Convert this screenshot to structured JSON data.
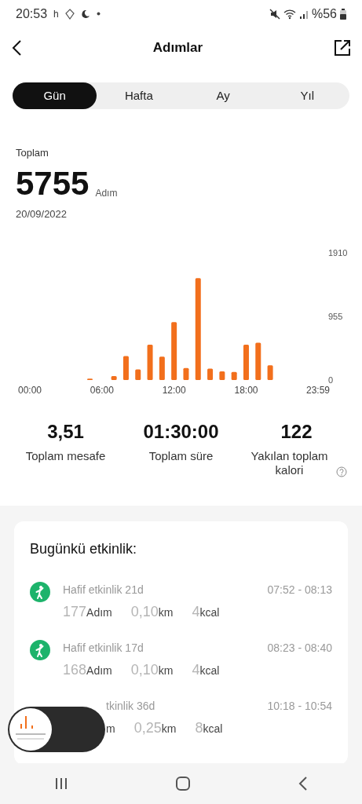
{
  "status_bar": {
    "time": "20:53",
    "left_glyph": "h",
    "battery": "%56"
  },
  "header": {
    "title": "Adımlar"
  },
  "tabs": [
    {
      "label": "Gün",
      "selected": true
    },
    {
      "label": "Hafta",
      "selected": false
    },
    {
      "label": "Ay",
      "selected": false
    },
    {
      "label": "Yıl",
      "selected": false
    }
  ],
  "summary": {
    "label": "Toplam",
    "value": "5755",
    "unit": "Adım",
    "date": "20/09/2022"
  },
  "chart": {
    "chart_data": {
      "type": "bar",
      "x": [
        0,
        1,
        2,
        3,
        4,
        5,
        6,
        7,
        8,
        9,
        10,
        11,
        12,
        13,
        14,
        15,
        16,
        17,
        18,
        19,
        20,
        21,
        22,
        23
      ],
      "xlim": [
        0,
        23.98
      ],
      "series": [
        {
          "color": "#f26f1c",
          "values": [
            0,
            0,
            0,
            0,
            0,
            20,
            0,
            60,
            360,
            160,
            530,
            350,
            870,
            180,
            1530,
            170,
            130,
            120,
            530,
            560,
            220,
            0,
            0,
            0
          ]
        }
      ],
      "xticks": [
        {
          "value": 0,
          "label": "00:00"
        },
        {
          "value": 6,
          "label": "06:00"
        },
        {
          "value": 12,
          "label": "12:00"
        },
        {
          "value": 18,
          "label": "18:00"
        },
        {
          "value": 23.98,
          "label": "23:59"
        }
      ],
      "yticks": [
        {
          "value": 0,
          "label": "0"
        },
        {
          "value": 955,
          "label": "955"
        },
        {
          "value": 1910,
          "label": "1910"
        }
      ],
      "ylim": [
        0,
        1910
      ]
    }
  },
  "stats": [
    {
      "value": "3,51",
      "label": "Toplam mesafe",
      "help": false
    },
    {
      "value": "01:30:00",
      "label": "Toplam süre",
      "help": false
    },
    {
      "value": "122",
      "label": "Yakılan toplam kalori",
      "help": true
    }
  ],
  "activity": {
    "title": "Bugünkü etkinlik:",
    "items": [
      {
        "title": "Hafif etkinlik 21d",
        "time": "07:52 - 08:13",
        "steps": "177",
        "steps_unit": "Adım",
        "distance": "0,10",
        "distance_unit": "km",
        "kcal": "4",
        "kcal_unit": "kcal",
        "covered": false
      },
      {
        "title": "Hafif etkinlik 17d",
        "time": "08:23 - 08:40",
        "steps": "168",
        "steps_unit": "Adım",
        "distance": "0,10",
        "distance_unit": "km",
        "kcal": "4",
        "kcal_unit": "kcal",
        "covered": false
      },
      {
        "title": "tkinlik 36d",
        "time": "10:18 - 10:54",
        "steps_unit": "m",
        "distance": "0,25",
        "distance_unit": "km",
        "kcal": "8",
        "kcal_unit": "kcal",
        "covered": true
      }
    ]
  }
}
